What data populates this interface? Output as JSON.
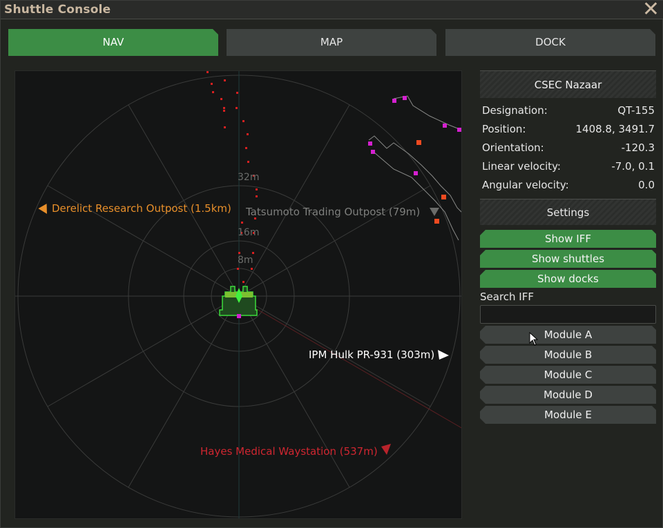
{
  "window": {
    "title": "Shuttle Console",
    "close_label": "✕"
  },
  "tabs": [
    {
      "label": "NAV",
      "active": true
    },
    {
      "label": "MAP",
      "active": false
    },
    {
      "label": "DOCK",
      "active": false
    }
  ],
  "radar": {
    "range_ticks": [
      "32m",
      "16m",
      "8m"
    ],
    "labels": [
      {
        "text": "Derelict Research Outpost (1.5km)",
        "color": "#e88f2a",
        "icon": "triangle-left-icon"
      },
      {
        "text": "Tatsumoto Trading Outpost (79m)",
        "color": "#7e7f7d",
        "icon": "triangle-right-icon"
      },
      {
        "text": "IPM Hulk PR-931 (303m)",
        "color": "#ffffff",
        "icon": "triangle-right-icon"
      },
      {
        "text": "Hayes Medical Waystation (537m)",
        "color": "#cf2630",
        "icon": "triangle-right-icon"
      }
    ]
  },
  "ship": {
    "name": "CSEC Nazaar",
    "stats": [
      {
        "key": "Designation:",
        "value": "QT-155"
      },
      {
        "key": "Position:",
        "value": "1408.8, 3491.7"
      },
      {
        "key": "Orientation:",
        "value": "-120.3"
      },
      {
        "key": "Linear velocity:",
        "value": "-7.0, 0.1"
      },
      {
        "key": "Angular velocity:",
        "value": "0.0"
      }
    ]
  },
  "settings": {
    "title": "Settings",
    "toggles": [
      "Show IFF",
      "Show shuttles",
      "Show docks"
    ],
    "search_label": "Search IFF",
    "search_value": "",
    "modules": [
      "Module A",
      "Module B",
      "Module C",
      "Module D",
      "Module E"
    ]
  },
  "colors": {
    "accent_green": "#3c8d45",
    "button_dark": "#3e4240",
    "radar_bg": "#141515"
  }
}
